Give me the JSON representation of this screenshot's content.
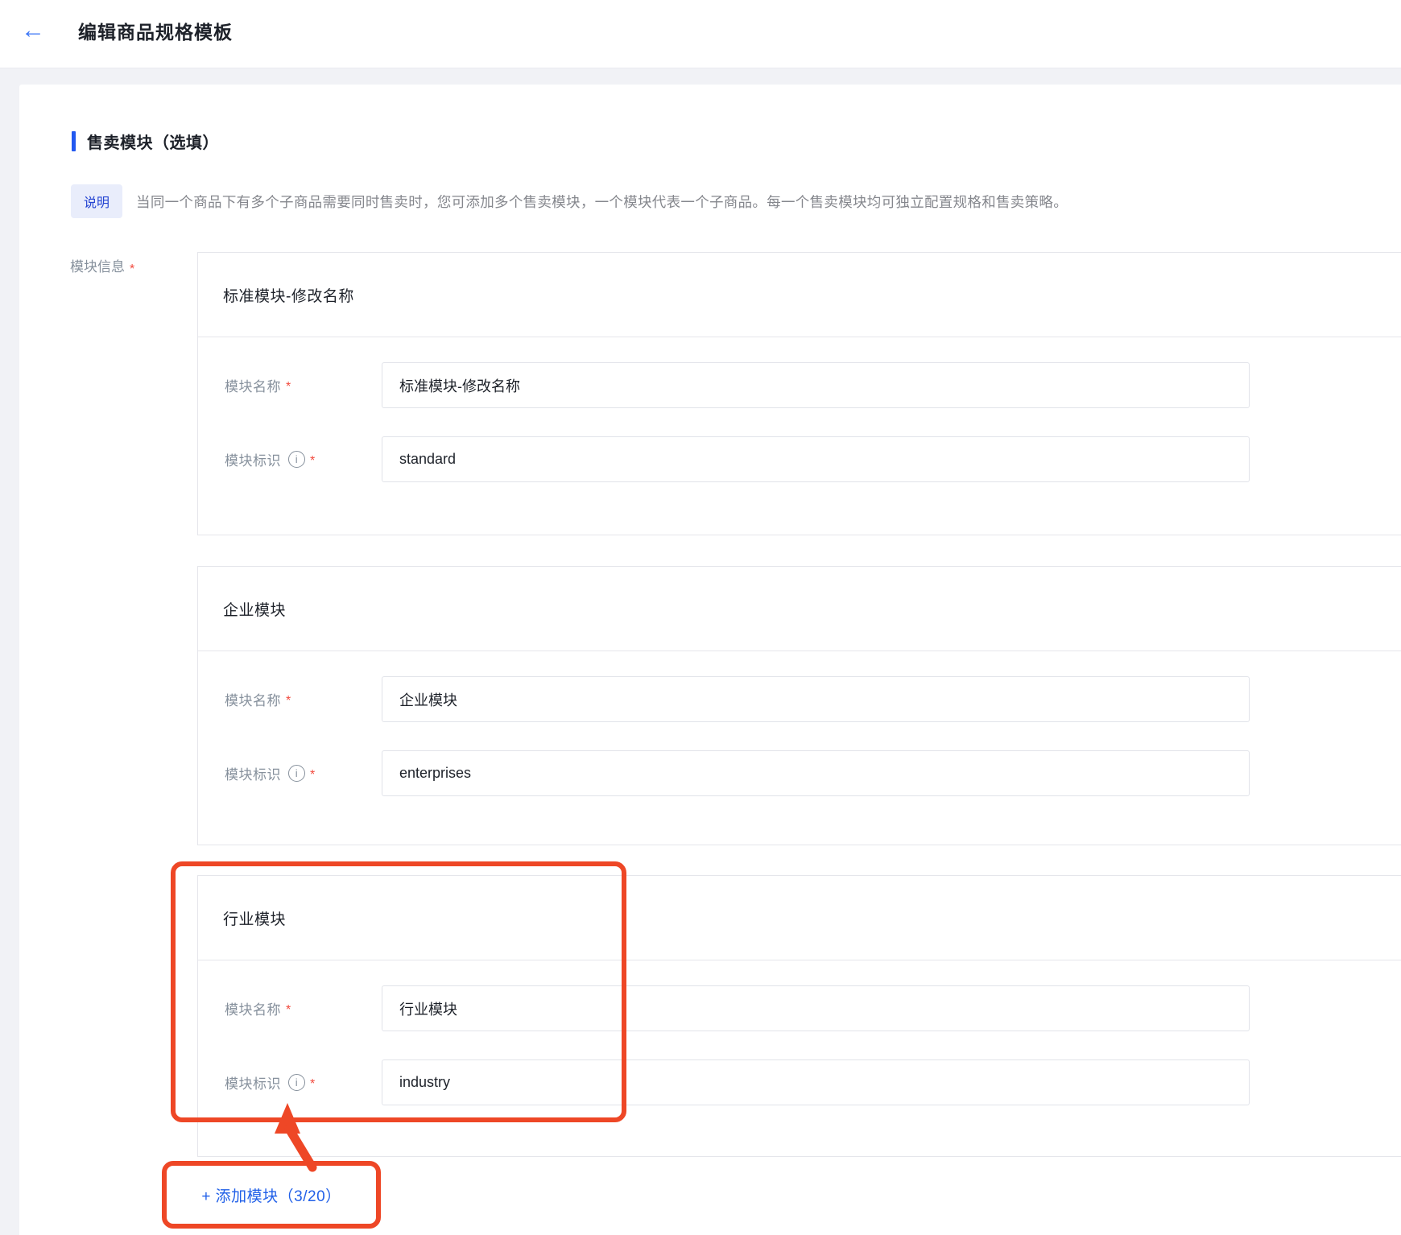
{
  "header": {
    "title": "编辑商品规格模板"
  },
  "icons": {
    "back_arrow": "←",
    "info": "i"
  },
  "section": {
    "title": "售卖模块（选填）",
    "note": {
      "badge": "说明",
      "text": "当同一个商品下有多个子商品需要同时售卖时，您可添加多个售卖模块，一个模块代表一个子商品。每一个售卖模块均可独立配置规格和售卖策略。"
    },
    "module_info_label": "模块信息",
    "required_mark": "*"
  },
  "field_labels": {
    "module_name": "模块名称",
    "module_id": "模块标识"
  },
  "modules": [
    {
      "title": "标准模块-修改名称",
      "module_name": "标准模块-修改名称",
      "module_id": "standard"
    },
    {
      "title": "企业模块",
      "module_name": "企业模块",
      "module_id": "enterprises"
    },
    {
      "title": "行业模块",
      "module_name": "行业模块",
      "module_id": "industry"
    }
  ],
  "add_module": {
    "label": "+ 添加模块（3/20）"
  },
  "colors": {
    "accent_blue": "#2258f0",
    "back_arrow_blue": "#3b76f6",
    "link_blue": "#2160e8",
    "badge_bg": "#e9edfb",
    "badge_text": "#2444d2",
    "annotation_red": "#ee4726",
    "required_red": "#f2493d",
    "label_gray": "#86909c",
    "text_dark": "#1d2129",
    "card_border": "#e5e6eb",
    "page_bg": "#f1f2f6"
  }
}
